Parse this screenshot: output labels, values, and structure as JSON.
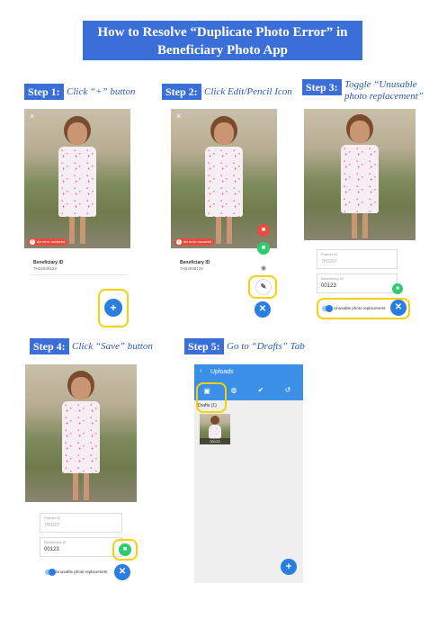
{
  "title": {
    "line1": "How to Resolve “Duplicate Photo Error” in",
    "line2": "Beneficiary Photo App"
  },
  "steps": [
    {
      "badge": "Step 1:",
      "text": "Click “+” button"
    },
    {
      "badge": "Step 2:",
      "text": "Click Edit/Pencil Icon"
    },
    {
      "badge": "Step 3:",
      "text_line1": "Toggle “Unusable",
      "text_line2": "photo replacement”"
    },
    {
      "badge": "Step 4:",
      "text": "Click “Save” button"
    },
    {
      "badge": "Step 5:",
      "text": "Go to “Drafts” Tab"
    }
  ],
  "phone": {
    "error_text": "An error occurred",
    "beneficiary_label": "Beneficiary ID",
    "beneficiary_value": "7H22030123",
    "partner_label": "Partner ID",
    "partner_value": "7H2207",
    "beneficiary_input": "00123",
    "toggle_label": "Unusable photo replacement",
    "uploads_title": "Uploads",
    "drafts_label": "Drafts (1)",
    "thumb_label": "00123"
  },
  "colors": {
    "accent": "#3b6fd8",
    "fab_blue": "#2a7de1",
    "save_green": "#2ecc71",
    "highlight": "#f5d10a",
    "delete_red": "#e74c3c"
  }
}
